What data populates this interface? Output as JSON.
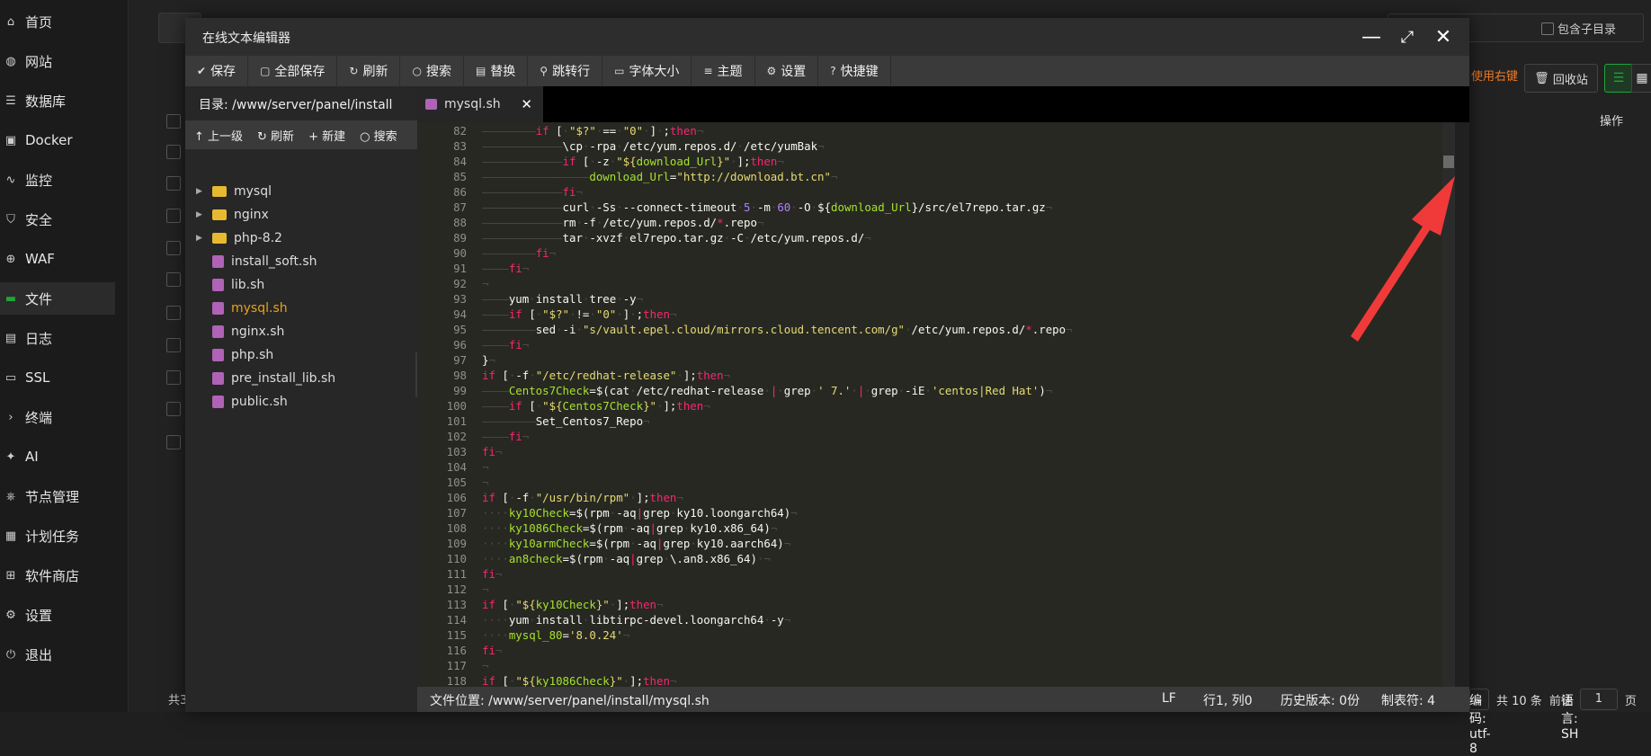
{
  "sidebar": {
    "items": [
      {
        "label": "首页",
        "icon": "home-icon"
      },
      {
        "label": "网站",
        "icon": "globe-icon"
      },
      {
        "label": "数据库",
        "icon": "database-icon"
      },
      {
        "label": "Docker",
        "icon": "docker-icon"
      },
      {
        "label": "监控",
        "icon": "monitor-icon"
      },
      {
        "label": "安全",
        "icon": "shield-icon"
      },
      {
        "label": "WAF",
        "icon": "waf-icon"
      },
      {
        "label": "文件",
        "icon": "folder-icon",
        "active": true
      },
      {
        "label": "日志",
        "icon": "log-icon"
      },
      {
        "label": "SSL",
        "icon": "ssl-icon"
      },
      {
        "label": "终端",
        "icon": "terminal-icon"
      },
      {
        "label": "AI",
        "icon": "ai-icon"
      },
      {
        "label": "节点管理",
        "icon": "node-icon"
      },
      {
        "label": "计划任务",
        "icon": "calendar-icon"
      },
      {
        "label": "软件商店",
        "icon": "store-icon"
      },
      {
        "label": "设置",
        "icon": "gear-icon"
      },
      {
        "label": "退出",
        "icon": "logout-icon"
      }
    ]
  },
  "background": {
    "include_subdir": "包含子目录",
    "right_menu": "使用右键",
    "recycle": "回收站",
    "operation": "操作",
    "footer_total": "共 10 条",
    "footer_goto": "前往",
    "footer_page": "1",
    "footer_page_unit": "页",
    "footer_left": "共3"
  },
  "dialog": {
    "title": "在线文本编辑器",
    "toolbar": [
      {
        "label": "保存",
        "icon": "save-icon",
        "glyph": "✔"
      },
      {
        "label": "全部保存",
        "icon": "save-all-icon",
        "glyph": "▢"
      },
      {
        "label": "刷新",
        "icon": "refresh-icon",
        "glyph": "↻"
      },
      {
        "label": "搜索",
        "icon": "search-icon",
        "glyph": "○"
      },
      {
        "label": "替换",
        "icon": "replace-icon",
        "glyph": "▤"
      },
      {
        "label": "跳转行",
        "icon": "goto-line-icon",
        "glyph": "⚲"
      },
      {
        "label": "字体大小",
        "icon": "font-size-icon",
        "glyph": "▭"
      },
      {
        "label": "主题",
        "icon": "theme-icon",
        "glyph": "≡"
      },
      {
        "label": "设置",
        "icon": "gear-icon",
        "glyph": "⚙"
      },
      {
        "label": "快捷键",
        "icon": "help-icon",
        "glyph": "?"
      }
    ],
    "tree": {
      "path": "目录: /www/server/panel/install",
      "actions": [
        {
          "label": "↑ 上一级",
          "name": "parent-dir-button"
        },
        {
          "label": "↻ 刷新",
          "name": "tree-refresh-button"
        },
        {
          "label": "+ 新建",
          "name": "tree-new-button"
        },
        {
          "label": "○ 搜索",
          "name": "tree-search-button"
        }
      ],
      "nodes": [
        {
          "label": "mysql",
          "type": "folder"
        },
        {
          "label": "nginx",
          "type": "folder"
        },
        {
          "label": "php-8.2",
          "type": "folder"
        },
        {
          "label": "install_soft.sh",
          "type": "file"
        },
        {
          "label": "lib.sh",
          "type": "file"
        },
        {
          "label": "mysql.sh",
          "type": "file",
          "selected": true
        },
        {
          "label": "nginx.sh",
          "type": "file"
        },
        {
          "label": "php.sh",
          "type": "file"
        },
        {
          "label": "pre_install_lib.sh",
          "type": "file"
        },
        {
          "label": "public.sh",
          "type": "file"
        }
      ]
    },
    "tab": {
      "label": "mysql.sh"
    },
    "code_lines": [
      {
        "n": "82",
        "html": "<span class='ws'>————————</span><span class='kw'>if</span> [<span class='ws'>·</span><span class='str'>\"$?\"</span><span class='ws'>·</span>==<span class='ws'>·</span><span class='str'>\"0\"</span><span class='ws'>·</span>]<span class='ws'>·</span>;<span class='kw'>then</span><span class='ws'>¬</span>"
      },
      {
        "n": "83",
        "html": "<span class='ws'>————————————</span>\\cp<span class='ws'>·</span>-rpa<span class='ws'>·</span>/etc/yum.repos.d/<span class='ws'>·</span>/etc/yumBak<span class='ws'>¬</span>"
      },
      {
        "n": "84",
        "html": "<span class='ws'>————————————</span><span class='kw'>if</span> [<span class='ws'>·</span>-z<span class='ws'>·</span><span class='str'>\"${<span class='var'>download_Url</span>}\"</span><span class='ws'>·</span>];<span class='kw'>then</span><span class='ws'>¬</span>"
      },
      {
        "n": "85",
        "html": "<span class='ws'>————————————————</span><span class='var'>download_Url</span>=<span class='str'>\"http://download.bt.cn\"</span><span class='ws'>¬</span>"
      },
      {
        "n": "86",
        "html": "<span class='ws'>————————————</span><span class='kw'>fi</span><span class='ws'>¬</span>"
      },
      {
        "n": "87",
        "html": "<span class='ws'>————————————</span>curl<span class='ws'>·</span>-Ss<span class='ws'>·</span>--connect-timeout<span class='ws'>·</span><span class='num'>5</span><span class='ws'>·</span>-m<span class='ws'>·</span><span class='num'>60</span><span class='ws'>·</span>-O<span class='ws'>·</span>${<span class='var'>download_Url</span>}/src/el7repo.tar.gz<span class='ws'>¬</span>"
      },
      {
        "n": "88",
        "html": "<span class='ws'>————————————</span>rm<span class='ws'>·</span>-f<span class='ws'>·</span>/etc/yum.repos.d/<span class='kw'>*</span>.repo<span class='ws'>¬</span>"
      },
      {
        "n": "89",
        "html": "<span class='ws'>————————————</span>tar<span class='ws'>·</span>-xvzf<span class='ws'>·</span>el7repo.tar.gz<span class='ws'>·</span>-C<span class='ws'>·</span>/etc/yum.repos.d/<span class='ws'>¬</span>"
      },
      {
        "n": "90",
        "html": "<span class='ws'>————————</span><span class='kw'>fi</span><span class='ws'>¬</span>"
      },
      {
        "n": "91",
        "html": "<span class='ws'>————</span><span class='kw'>fi</span><span class='ws'>¬</span>"
      },
      {
        "n": "92",
        "html": "<span class='ws'>¬</span>"
      },
      {
        "n": "93",
        "html": "<span class='ws'>————</span>yum<span class='ws'>·</span>install<span class='ws'>·</span>tree<span class='ws'>·</span>-y<span class='ws'>¬</span>"
      },
      {
        "n": "94",
        "html": "<span class='ws'>————</span><span class='kw'>if</span> [<span class='ws'>·</span><span class='str'>\"$?\"</span><span class='ws'>·</span>!=<span class='ws'>·</span><span class='str'>\"0\"</span><span class='ws'>·</span>]<span class='ws'>·</span>;<span class='kw'>then</span><span class='ws'>¬</span>"
      },
      {
        "n": "95",
        "html": "<span class='ws'>————————</span>sed<span class='ws'>·</span>-i<span class='ws'>·</span><span class='str'>\"s/vault.epel.cloud/mirrors.cloud.tencent.com/g\"</span><span class='ws'>·</span>/etc/yum.repos.d/<span class='kw'>*</span>.repo<span class='ws'>¬</span>"
      },
      {
        "n": "96",
        "html": "<span class='ws'>————</span><span class='kw'>fi</span><span class='ws'>¬</span>"
      },
      {
        "n": "97",
        "html": "}<span class='ws'>¬</span>"
      },
      {
        "n": "98",
        "html": "<span class='kw'>if</span> [<span class='ws'>·</span>-f<span class='ws'>·</span><span class='str'>\"/etc/redhat-release\"</span><span class='ws'>·</span>];<span class='kw'>then</span><span class='ws'>¬</span>"
      },
      {
        "n": "99",
        "html": "<span class='ws'>————</span><span class='var'>Centos7Check</span>=$(cat<span class='ws'>·</span>/etc/redhat-release<span class='ws'>·</span><span class='kw'>|</span><span class='ws'>·</span>grep<span class='ws'>·</span><span class='str'>' 7.'</span><span class='ws'>·</span><span class='kw'>|</span><span class='ws'>·</span>grep<span class='ws'>·</span>-iE<span class='ws'>·</span><span class='str'>'centos|Red Hat'</span>)<span class='ws'>¬</span>"
      },
      {
        "n": "100",
        "html": "<span class='ws'>————</span><span class='kw'>if</span> [<span class='ws'>·</span><span class='str'>\"${<span class='var'>Centos7Check</span>}\"</span><span class='ws'>·</span>];<span class='kw'>then</span><span class='ws'>¬</span>"
      },
      {
        "n": "101",
        "html": "<span class='ws'>————————</span>Set_Centos7_Repo<span class='ws'>¬</span>"
      },
      {
        "n": "102",
        "html": "<span class='ws'>————</span><span class='kw'>fi</span><span class='ws'>¬</span>"
      },
      {
        "n": "103",
        "html": "<span class='kw'>fi</span><span class='ws'>¬</span>"
      },
      {
        "n": "104",
        "html": "<span class='ws'>¬</span>"
      },
      {
        "n": "105",
        "html": "<span class='ws'>¬</span>"
      },
      {
        "n": "106",
        "html": "<span class='kw'>if</span> [<span class='ws'>·</span>-f<span class='ws'>·</span><span class='str'>\"/usr/bin/rpm\"</span><span class='ws'>·</span>];<span class='kw'>then</span><span class='ws'>¬</span>"
      },
      {
        "n": "107",
        "html": "<span class='ws'>····</span><span class='var'>ky10Check</span>=$(rpm<span class='ws'>·</span>-aq<span class='kw'>|</span>grep<span class='ws'>·</span>ky10.loongarch64)<span class='ws'>¬</span>"
      },
      {
        "n": "108",
        "html": "<span class='ws'>····</span><span class='var'>ky1086Check</span>=$(rpm<span class='ws'>·</span>-aq<span class='kw'>|</span>grep<span class='ws'>·</span>ky10.x86_64)<span class='ws'>¬</span>"
      },
      {
        "n": "109",
        "html": "<span class='ws'>····</span><span class='var'>ky10armCheck</span>=$(rpm<span class='ws'>·</span>-aq<span class='kw'>|</span>grep<span class='ws'>·</span>ky10.aarch64)<span class='ws'>¬</span>"
      },
      {
        "n": "110",
        "html": "<span class='ws'>····</span><span class='var'>an8check</span>=$(rpm<span class='ws'>·</span>-aq<span class='kw'>|</span>grep<span class='ws'>·</span>\\.an8.x86_64)<span class='ws'>·¬</span>"
      },
      {
        "n": "111",
        "html": "<span class='kw'>fi</span><span class='ws'>¬</span>"
      },
      {
        "n": "112",
        "html": "<span class='ws'>¬</span>"
      },
      {
        "n": "113",
        "html": "<span class='kw'>if</span> [<span class='ws'>·</span><span class='str'>\"${<span class='var'>ky10Check</span>}\"</span><span class='ws'>·</span>];<span class='kw'>then</span><span class='ws'>¬</span>"
      },
      {
        "n": "114",
        "html": "<span class='ws'>····</span>yum<span class='ws'>·</span>install<span class='ws'>·</span>libtirpc-devel.loongarch64<span class='ws'>·</span>-y<span class='ws'>¬</span>"
      },
      {
        "n": "115",
        "html": "<span class='ws'>····</span><span class='var'>mysql_80</span>=<span class='str'>'8.0.24'</span><span class='ws'>¬</span>"
      },
      {
        "n": "116",
        "html": "<span class='kw'>fi</span><span class='ws'>¬</span>"
      },
      {
        "n": "117",
        "html": "<span class='ws'>¬</span>"
      },
      {
        "n": "118",
        "html": "<span class='kw'>if</span> [<span class='ws'>·</span><span class='str'>\"${<span class='var'>ky1086Check</span>}\"</span><span class='ws'>·</span>];<span class='kw'>then</span><span class='ws'>¬</span>"
      }
    ],
    "status": {
      "file_path": "文件位置: /www/server/panel/install/mysql.sh",
      "line_ending": "LF",
      "cursor": "行1, 列0",
      "history": "历史版本: 0份",
      "tab_size": "制表符: 4",
      "encoding": "编码: utf-8",
      "language": "语言: SH"
    }
  },
  "colors": {
    "accent": "#20a53a",
    "arrow": "#f03a3a",
    "selected_file": "#e8a21a"
  }
}
